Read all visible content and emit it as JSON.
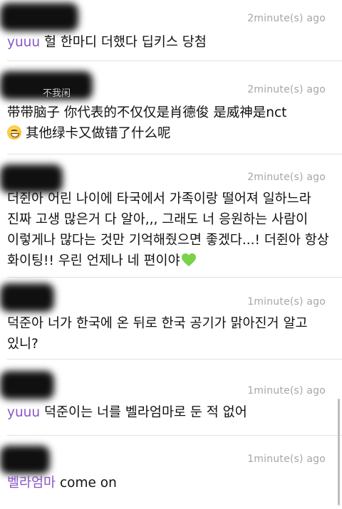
{
  "comments": [
    {
      "time": "2minute(s) ago",
      "reply_to": "yuuu",
      "text": " 헐 한마디 더했다 딥키스 당첨"
    },
    {
      "time": "2minute(s) ago",
      "ghost_name": "不我闲",
      "reply_to": "",
      "text": "带带脑子 你代表的不仅仅是肖德俊 是威神是nct\n",
      "emoji": "sweat-smile-emoji",
      "text2": "其他绿卡又做错了什么呢"
    },
    {
      "time": "2minute(s) ago",
      "text": "더쥔아 어린 나이에 타국에서 가족이랑 떨어져 일하느라 진짜 고생 많은거 다 알아,,, 그래도 너 응원하는 사람이 이렇게나 많다는 것만 기억해줬으면 좋겠다...! 더쥔아 항상 화이팅!! 우린 언제나 네 편이야",
      "emoji": "green-heart-emoji"
    },
    {
      "time": "1minute(s) ago",
      "text": "덕준아 너가 한국에 온 뒤로 한국 공기가 맑아진거 알고 있니?"
    },
    {
      "time": "1minute(s) ago",
      "reply_to": "yuuu",
      "text": " 덕준이는 너를 벨라엄마로 둔 적 없어"
    },
    {
      "time": "1minute(s) ago",
      "reply_to": "벨라엄마",
      "text": " come on"
    }
  ],
  "colors": {
    "reply_accent": "#8a55c8",
    "timestamp": "#a6a6a6",
    "redaction": "#101010"
  }
}
